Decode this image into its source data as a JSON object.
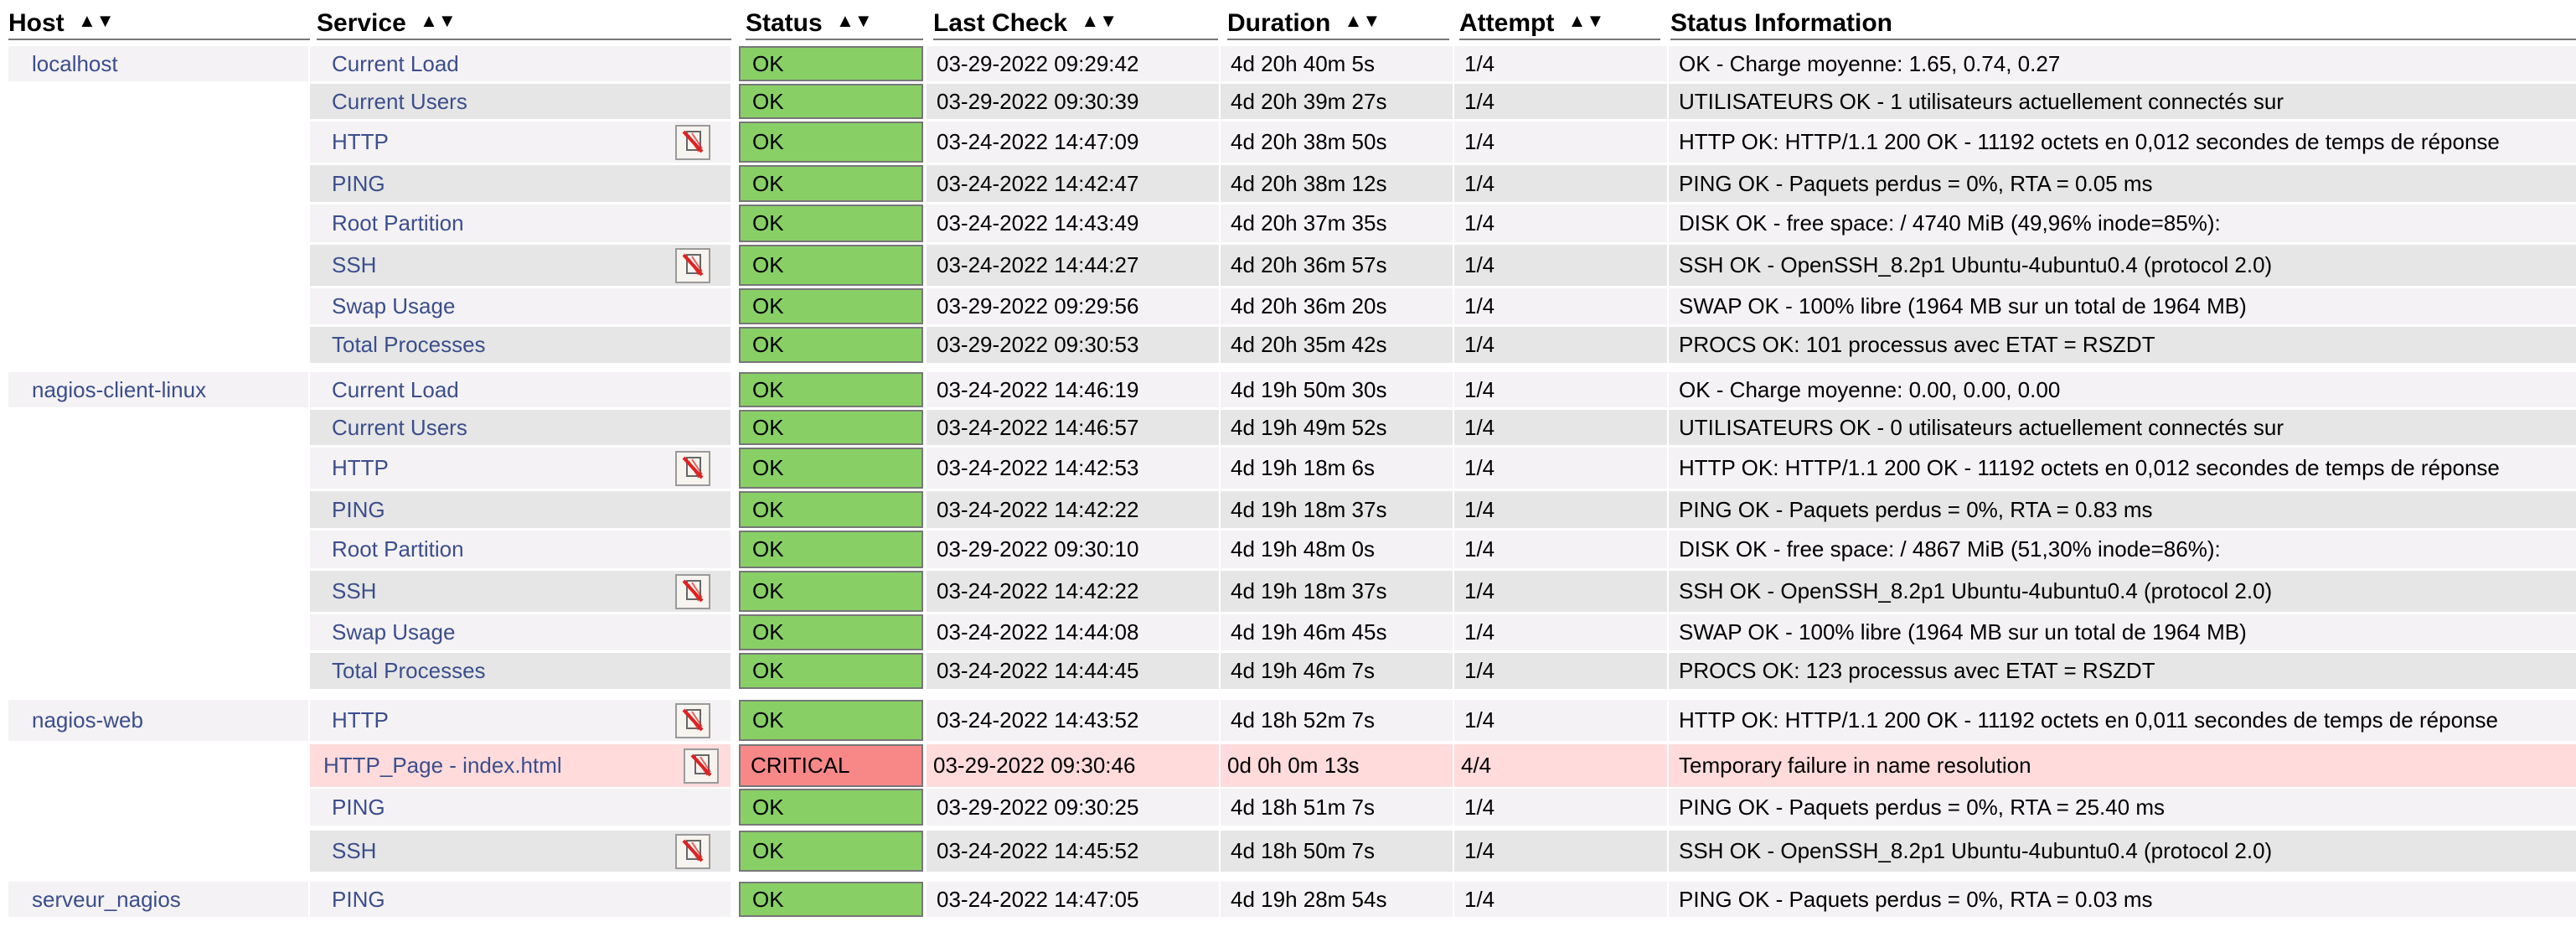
{
  "headers": [
    {
      "label": "Host",
      "sortable": true
    },
    {
      "label": "Service",
      "sortable": true
    },
    {
      "label": "Status",
      "sortable": true
    },
    {
      "label": "Last Check",
      "sortable": true
    },
    {
      "label": "Duration",
      "sortable": true
    },
    {
      "label": "Attempt",
      "sortable": true
    },
    {
      "label": "Status Information",
      "sortable": false
    }
  ],
  "colors": {
    "ok": "#88d066",
    "critical": "#f88888",
    "critical_row": "#ffdbdb",
    "link": "#3b4e8c",
    "row_odd": "#f4f2f4",
    "row_even": "#e6e6e6"
  },
  "rows": [
    {
      "host": "localhost",
      "service": "Current Load",
      "flap": false,
      "status": "OK",
      "last_check": "03-29-2022 09:29:42",
      "duration": "4d 20h 40m 5s",
      "attempt": "1/4",
      "info": "OK - Charge moyenne: 1.65, 0.74, 0.27"
    },
    {
      "host": "",
      "service": "Current Users",
      "flap": false,
      "status": "OK",
      "last_check": "03-29-2022 09:30:39",
      "duration": "4d 20h 39m 27s",
      "attempt": "1/4",
      "info": "UTILISATEURS OK - 1 utilisateurs actuellement connectés sur"
    },
    {
      "host": "",
      "service": "HTTP",
      "flap": true,
      "status": "OK",
      "last_check": "03-24-2022 14:47:09",
      "duration": "4d 20h 38m 50s",
      "attempt": "1/4",
      "info": "HTTP OK: HTTP/1.1 200 OK - 11192 octets en 0,012 secondes de temps de réponse"
    },
    {
      "host": "",
      "service": "PING",
      "flap": false,
      "status": "OK",
      "last_check": "03-24-2022 14:42:47",
      "duration": "4d 20h 38m 12s",
      "attempt": "1/4",
      "info": "PING OK - Paquets perdus = 0%, RTA = 0.05 ms"
    },
    {
      "host": "",
      "service": "Root Partition",
      "flap": false,
      "status": "OK",
      "last_check": "03-24-2022 14:43:49",
      "duration": "4d 20h 37m 35s",
      "attempt": "1/4",
      "info": "DISK OK - free space: / 4740 MiB (49,96% inode=85%):"
    },
    {
      "host": "",
      "service": "SSH",
      "flap": true,
      "status": "OK",
      "last_check": "03-24-2022 14:44:27",
      "duration": "4d 20h 36m 57s",
      "attempt": "1/4",
      "info": "SSH OK - OpenSSH_8.2p1 Ubuntu-4ubuntu0.4 (protocol 2.0)"
    },
    {
      "host": "",
      "service": "Swap Usage",
      "flap": false,
      "status": "OK",
      "last_check": "03-29-2022 09:29:56",
      "duration": "4d 20h 36m 20s",
      "attempt": "1/4",
      "info": "SWAP OK - 100% libre (1964 MB sur un total de 1964 MB)"
    },
    {
      "host": "",
      "service": "Total Processes",
      "flap": false,
      "status": "OK",
      "last_check": "03-29-2022 09:30:53",
      "duration": "4d 20h 35m 42s",
      "attempt": "1/4",
      "info": "PROCS OK: 101 processus avec ETAT = RSZDT"
    },
    {
      "host": "nagios-client-linux",
      "service": "Current Load",
      "flap": false,
      "status": "OK",
      "last_check": "03-24-2022 14:46:19",
      "duration": "4d 19h 50m 30s",
      "attempt": "1/4",
      "info": "OK - Charge moyenne: 0.00, 0.00, 0.00"
    },
    {
      "host": "",
      "service": "Current Users",
      "flap": false,
      "status": "OK",
      "last_check": "03-24-2022 14:46:57",
      "duration": "4d 19h 49m 52s",
      "attempt": "1/4",
      "info": "UTILISATEURS OK - 0 utilisateurs actuellement connectés sur"
    },
    {
      "host": "",
      "service": "HTTP",
      "flap": true,
      "status": "OK",
      "last_check": "03-24-2022 14:42:53",
      "duration": "4d 19h 18m 6s",
      "attempt": "1/4",
      "info": "HTTP OK: HTTP/1.1 200 OK - 11192 octets en 0,012 secondes de temps de réponse"
    },
    {
      "host": "",
      "service": "PING",
      "flap": false,
      "status": "OK",
      "last_check": "03-24-2022 14:42:22",
      "duration": "4d 19h 18m 37s",
      "attempt": "1/4",
      "info": "PING OK - Paquets perdus = 0%, RTA = 0.83 ms"
    },
    {
      "host": "",
      "service": "Root Partition",
      "flap": false,
      "status": "OK",
      "last_check": "03-29-2022 09:30:10",
      "duration": "4d 19h 48m 0s",
      "attempt": "1/4",
      "info": "DISK OK - free space: / 4867 MiB (51,30% inode=86%):"
    },
    {
      "host": "",
      "service": "SSH",
      "flap": true,
      "status": "OK",
      "last_check": "03-24-2022 14:42:22",
      "duration": "4d 19h 18m 37s",
      "attempt": "1/4",
      "info": "SSH OK - OpenSSH_8.2p1 Ubuntu-4ubuntu0.4 (protocol 2.0)"
    },
    {
      "host": "",
      "service": "Swap Usage",
      "flap": false,
      "status": "OK",
      "last_check": "03-24-2022 14:44:08",
      "duration": "4d 19h 46m 45s",
      "attempt": "1/4",
      "info": "SWAP OK - 100% libre (1964 MB sur un total de 1964 MB)"
    },
    {
      "host": "",
      "service": "Total Processes",
      "flap": false,
      "status": "OK",
      "last_check": "03-24-2022 14:44:45",
      "duration": "4d 19h 46m 7s",
      "attempt": "1/4",
      "info": "PROCS OK: 123 processus avec ETAT = RSZDT"
    },
    {
      "host": "nagios-web",
      "service": "HTTP",
      "flap": true,
      "status": "OK",
      "last_check": "03-24-2022 14:43:52",
      "duration": "4d 18h 52m 7s",
      "attempt": "1/4",
      "info": "HTTP OK: HTTP/1.1 200 OK - 11192 octets en 0,011 secondes de temps de réponse"
    },
    {
      "host": "",
      "service": "HTTP_Page - index.html",
      "flap": true,
      "status": "CRITICAL",
      "last_check": "03-29-2022 09:30:46",
      "duration": "0d 0h 0m 13s",
      "attempt": "4/4",
      "info": "Temporary failure in name resolution"
    },
    {
      "host": "",
      "service": "PING",
      "flap": false,
      "status": "OK",
      "last_check": "03-29-2022 09:30:25",
      "duration": "4d 18h 51m 7s",
      "attempt": "1/4",
      "info": "PING OK - Paquets perdus = 0%, RTA = 25.40 ms"
    },
    {
      "host": "",
      "service": "SSH",
      "flap": true,
      "status": "OK",
      "last_check": "03-24-2022 14:45:52",
      "duration": "4d 18h 50m 7s",
      "attempt": "1/4",
      "info": "SSH OK - OpenSSH_8.2p1 Ubuntu-4ubuntu0.4 (protocol 2.0)"
    },
    {
      "host": "serveur_nagios",
      "service": "PING",
      "flap": false,
      "status": "OK",
      "last_check": "03-24-2022 14:47:05",
      "duration": "4d 19h 28m 54s",
      "attempt": "1/4",
      "info": "PING OK - Paquets perdus = 0%, RTA = 0.03 ms"
    }
  ]
}
